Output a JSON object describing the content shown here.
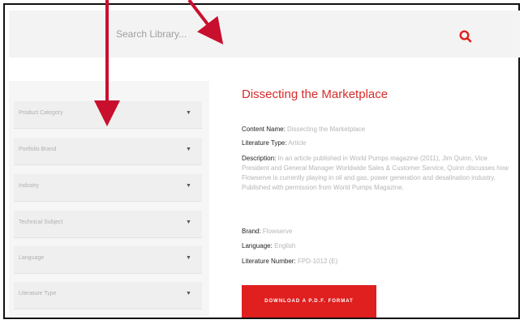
{
  "search": {
    "placeholder": "Search Library..."
  },
  "filters": [
    {
      "label": "Product Category"
    },
    {
      "label": "Portfolio Brand"
    },
    {
      "label": "Industry"
    },
    {
      "label": "Technical Subject"
    },
    {
      "label": "Language"
    },
    {
      "label": "Literature Type"
    }
  ],
  "article": {
    "title": "Dissecting the Marketplace",
    "content_name_label": "Content Name:",
    "content_name_value": "Dissecting the Marketplace",
    "literature_type_label": "Literature Type:",
    "literature_type_value": "Article",
    "description_label": "Description:",
    "description_value": "In an article published in World Pumps magazine (2011), Jim Quinn, Vice President and General Manager Worldwide Sales & Customer Service, Quinn discusses how Flowserve is currently playing in oil and gas, power generation and desalination industry. Published with permission from World Pumps Magazine.",
    "brand_label": "Brand:",
    "brand_value": "Flowserve",
    "language_label": "Language:",
    "language_value": "English",
    "literature_number_label": "Literature Number:",
    "literature_number_value": "FPD-1012 (E)",
    "download_label": "DOWNLOAD A P.D.F. FORMAT"
  },
  "colors": {
    "accent": "#e01f1f",
    "title": "#d62b2b",
    "arrow": "#c8102e"
  },
  "icons": {
    "search": "magnifier-icon",
    "caret": "caret-down-icon"
  }
}
